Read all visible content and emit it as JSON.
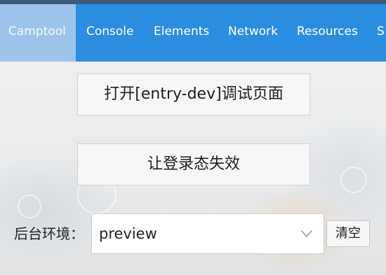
{
  "tabs": [
    {
      "label": "Camptool",
      "active": true
    },
    {
      "label": "Console",
      "active": false
    },
    {
      "label": "Elements",
      "active": false
    },
    {
      "label": "Network",
      "active": false
    },
    {
      "label": "Resources",
      "active": false
    },
    {
      "label": "S",
      "active": false
    }
  ],
  "actions": {
    "open_debug_label": "打开[entry-dev]调试页面",
    "invalidate_login_label": "让登录态失效"
  },
  "env": {
    "label": "后台环境：",
    "selected_value": "preview",
    "arrow_icon": "chevron-down-icon",
    "clear_label": "清空"
  },
  "colors": {
    "tabbar_bg": "#2b8ee0",
    "active_tab_bg": "#9cc4ea",
    "button_bg": "#f7f7f7"
  }
}
